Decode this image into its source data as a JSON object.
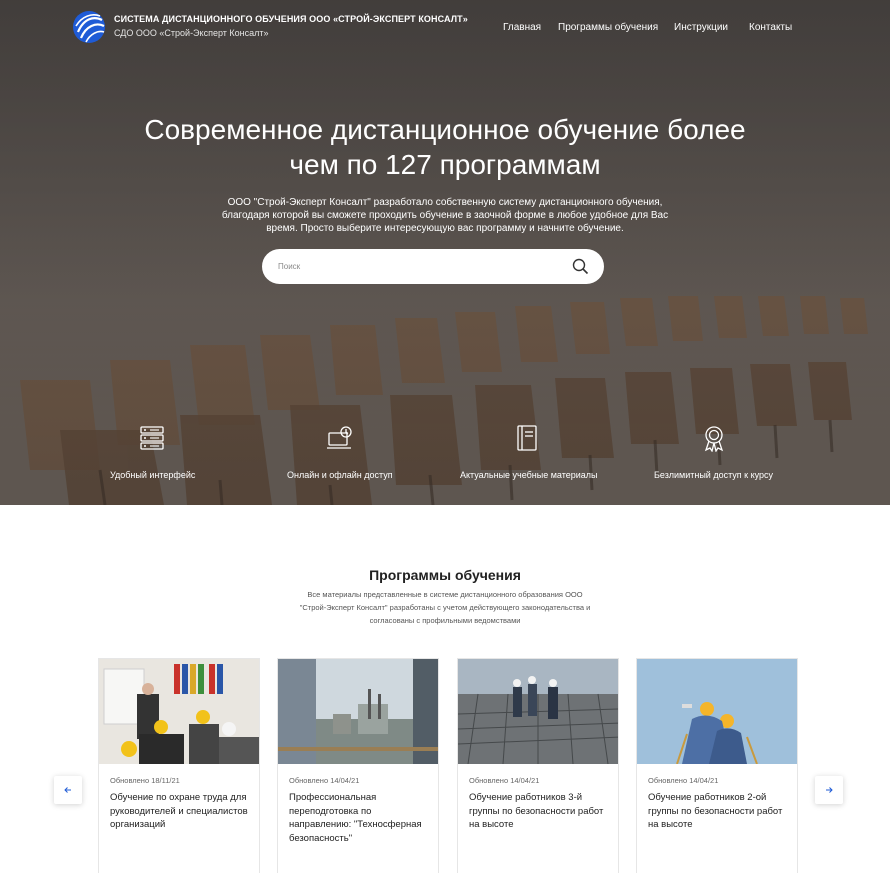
{
  "header": {
    "brand_title": "СИСТЕМА ДИСТАНЦИОННОГО ОБУЧЕНИЯ ООО «СТРОЙ-ЭКСПЕРТ КОНСАЛТ»",
    "brand_subtitle": "СДО ООО «Строй-Эксперт Консалт»",
    "nav": [
      "Главная",
      "Программы обучения",
      "Инструкции",
      "Контакты"
    ]
  },
  "hero": {
    "title_line1": "Современное дистанционное обучение более",
    "title_line2": "чем по 127 программам",
    "text_line1": "ООО \"Строй-Эксперт Консалт\" разработало собственную систему дистанционного обучения,",
    "text_line2": "благодаря которой вы сможете проходить обучение в заочной форме в любое удобное для Вас",
    "text_line3": "время. Просто выберите интересующую вас программу и начните обучение.",
    "search_placeholder": "Поиск"
  },
  "features": [
    {
      "icon": "server-icon",
      "label": "Удобный интерфейс"
    },
    {
      "icon": "online-offline-icon",
      "label": "Онлайн и офлайн доступ"
    },
    {
      "icon": "book-icon",
      "label": "Актуальные учебные материалы"
    },
    {
      "icon": "award-icon",
      "label": "Безлимитный доступ к курсу"
    }
  ],
  "programs": {
    "title": "Программы обучения",
    "desc_line1": "Все материалы представленные в системе дистанционного образования ООО",
    "desc_line2": "\"Строй-Эксперт Консалт\" разработаны с учетом действующего законодательства и",
    "desc_line3": "согласованы с профильными ведомствами",
    "cards": [
      {
        "date": "Обновлено 18/11/21",
        "title": "Обучение по охране труда для руководителей и специалистов организаций"
      },
      {
        "date": "Обновлено 14/04/21",
        "title": "Профессиональная переподготовка по направлению: \"Техносферная безопасность\""
      },
      {
        "date": "Обновлено 14/04/21",
        "title": "Обучение работников 3-й группы по безопасности работ на высоте"
      },
      {
        "date": "Обновлено 14/04/21",
        "title": "Обучение работников 2-ой группы по безопасности работ на высоте"
      }
    ]
  },
  "colors": {
    "accent_blue": "#1f5bd6",
    "hero_overlay": "#3a3532",
    "text_dark": "#222222"
  }
}
